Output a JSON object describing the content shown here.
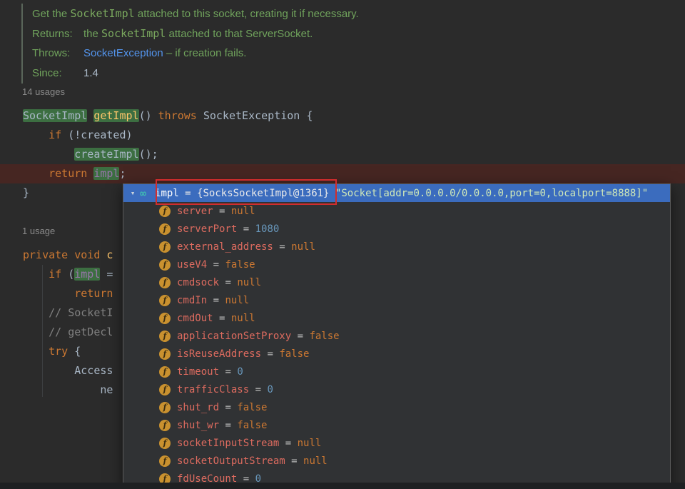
{
  "colors": {
    "selection_blue": "#3b6cbe",
    "annotation_red": "#d22d2d",
    "usage_highlight_green": "#3c6e41",
    "execution_line_red": "#462622",
    "link_blue": "#5394ec",
    "doc_green": "#70a35c",
    "keyword_orange": "#cc7832",
    "field_icon_orange": "#c9912f"
  },
  "doc_block": {
    "lines": [
      {
        "segments": [
          {
            "t": "Get the ",
            "c": "doc"
          },
          {
            "t": "SocketImpl",
            "c": "doccode"
          },
          {
            "t": " attached to this socket, creating it if necessary.",
            "c": "doc"
          }
        ]
      },
      {
        "label": "Returns:",
        "segments": [
          {
            "t": "the ",
            "c": "doc"
          },
          {
            "t": "SocketImpl",
            "c": "doccode"
          },
          {
            "t": " attached to that ServerSocket.",
            "c": "doc"
          }
        ]
      },
      {
        "label": "Throws:",
        "segments": [
          {
            "t": "SocketException",
            "c": "link"
          },
          {
            "t": " – if creation fails.",
            "c": "doc"
          }
        ]
      },
      {
        "label": "Since:",
        "segments": [
          {
            "t": "1.4",
            "c": "plainval"
          }
        ]
      }
    ]
  },
  "usage_labels": {
    "first": "14 usages",
    "second": "1 usage"
  },
  "code_block_1": {
    "lines": [
      {
        "segments": [
          {
            "t": "SocketImpl",
            "c": "plain",
            "hl": true
          },
          {
            "t": " ",
            "c": "plain"
          },
          {
            "t": "getImpl",
            "c": "method",
            "hl": true
          },
          {
            "t": "() ",
            "c": "plain"
          },
          {
            "t": "throws",
            "c": "kw"
          },
          {
            "t": " SocketException {",
            "c": "plain"
          }
        ]
      },
      {
        "segments": [
          {
            "t": "    ",
            "c": "plain"
          },
          {
            "t": "if",
            "c": "kw"
          },
          {
            "t": " (!created)",
            "c": "plain"
          }
        ]
      },
      {
        "segments": [
          {
            "t": "        ",
            "c": "plain"
          },
          {
            "t": "createImpl",
            "c": "plain",
            "hl": true
          },
          {
            "t": "();",
            "c": "plain"
          }
        ]
      },
      {
        "exec": true,
        "segments": [
          {
            "t": "    ",
            "c": "plain"
          },
          {
            "t": "return ",
            "c": "kw"
          },
          {
            "t": "impl",
            "c": "field",
            "hl": true
          },
          {
            "t": ";",
            "c": "plain"
          }
        ]
      },
      {
        "segments": [
          {
            "t": "}",
            "c": "plain"
          }
        ]
      }
    ]
  },
  "code_block_2": {
    "lines": [
      {
        "segments": [
          {
            "t": "private void ",
            "c": "kw"
          },
          {
            "t": "c",
            "c": "method"
          }
        ]
      },
      {
        "segments": [
          {
            "t": "    ",
            "c": "plain"
          },
          {
            "t": "if",
            "c": "kw"
          },
          {
            "t": " (",
            "c": "plain"
          },
          {
            "t": "impl",
            "c": "field",
            "hl": true
          },
          {
            "t": " =",
            "c": "plain"
          }
        ]
      },
      {
        "segments": [
          {
            "t": "        ",
            "c": "plain"
          },
          {
            "t": "return",
            "c": "kw"
          }
        ]
      },
      {
        "segments": [
          {
            "t": "    ",
            "c": "plain"
          },
          {
            "t": "// SocketI",
            "c": "comment"
          }
        ]
      },
      {
        "segments": [
          {
            "t": "    ",
            "c": "plain"
          },
          {
            "t": "// getDecl",
            "c": "comment"
          }
        ]
      },
      {
        "segments": [
          {
            "t": "    ",
            "c": "plain"
          },
          {
            "t": "try",
            "c": "kw"
          },
          {
            "t": " {",
            "c": "plain"
          }
        ]
      },
      {
        "segments": [
          {
            "t": "        Access",
            "c": "plain"
          }
        ]
      },
      {
        "segments": [
          {
            "t": "            ne",
            "c": "plain"
          }
        ]
      }
    ]
  },
  "popup": {
    "header": {
      "expander": "▾",
      "watch_icon": "∞",
      "name": "impl",
      "separator": " = ",
      "reference": "{SocksSocketImpl@1361} ",
      "value": "\"Socket[addr=0.0.0.0/0.0.0.0,port=0,localport=8888]\""
    },
    "field_icon_letter": "f",
    "fields": [
      {
        "name": "server",
        "eq": " = ",
        "value": "null",
        "vtype": "kw"
      },
      {
        "name": "serverPort",
        "eq": " = ",
        "value": "1080",
        "vtype": "num"
      },
      {
        "name": "external_address",
        "eq": " = ",
        "value": "null",
        "vtype": "kw"
      },
      {
        "name": "useV4",
        "eq": " = ",
        "value": "false",
        "vtype": "kw"
      },
      {
        "name": "cmdsock",
        "eq": " = ",
        "value": "null",
        "vtype": "kw"
      },
      {
        "name": "cmdIn",
        "eq": " = ",
        "value": "null",
        "vtype": "kw"
      },
      {
        "name": "cmdOut",
        "eq": " = ",
        "value": "null",
        "vtype": "kw"
      },
      {
        "name": "applicationSetProxy",
        "eq": " = ",
        "value": "false",
        "vtype": "kw"
      },
      {
        "name": "isReuseAddress",
        "eq": " = ",
        "value": "false",
        "vtype": "kw"
      },
      {
        "name": "timeout",
        "eq": " = ",
        "value": "0",
        "vtype": "num"
      },
      {
        "name": "trafficClass",
        "eq": " = ",
        "value": "0",
        "vtype": "num"
      },
      {
        "name": "shut_rd",
        "eq": " = ",
        "value": "false",
        "vtype": "kw"
      },
      {
        "name": "shut_wr",
        "eq": " = ",
        "value": "false",
        "vtype": "kw"
      },
      {
        "name": "socketInputStream",
        "eq": " = ",
        "value": "null",
        "vtype": "kw"
      },
      {
        "name": "socketOutputStream",
        "eq": " = ",
        "value": "null",
        "vtype": "kw"
      },
      {
        "name": "fdUseCount",
        "eq": " = ",
        "value": "0",
        "vtype": "num"
      }
    ]
  }
}
